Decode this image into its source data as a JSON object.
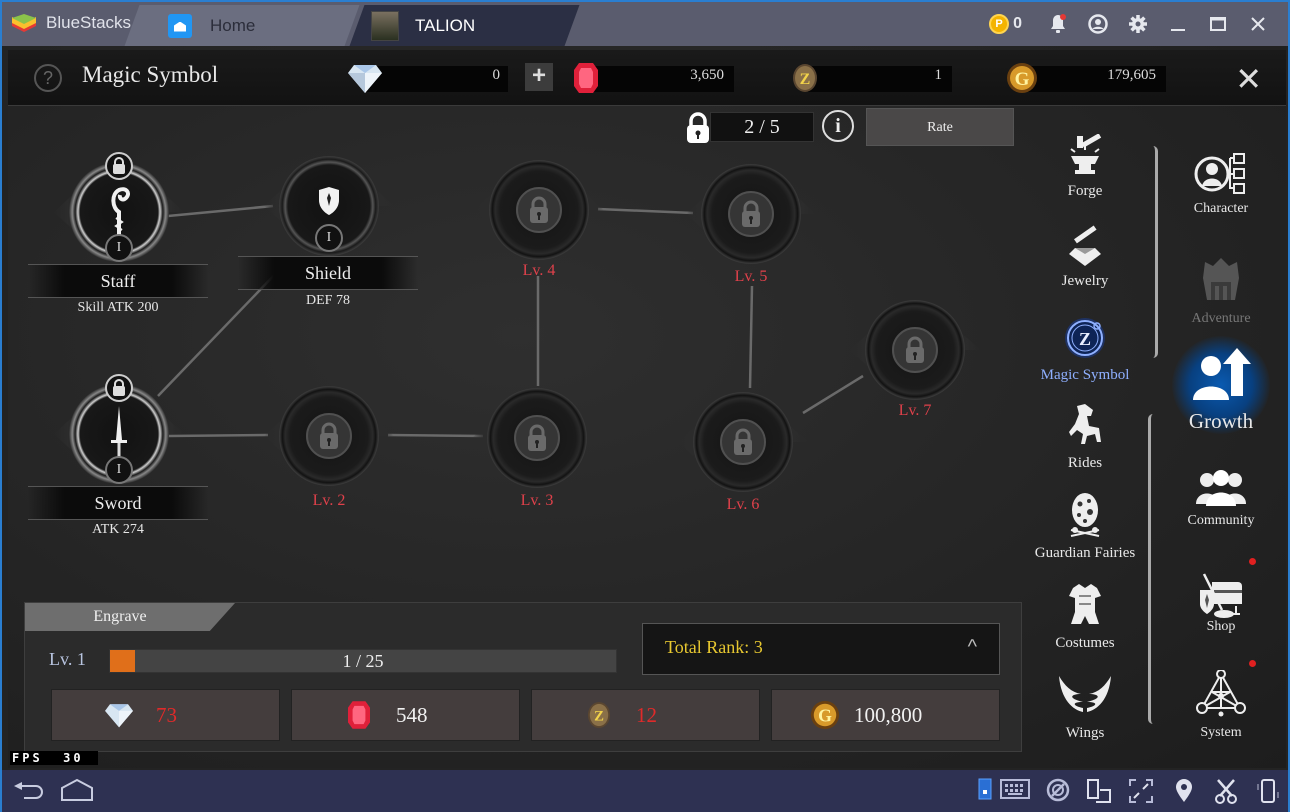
{
  "titlebar": {
    "app_name": "BlueStacks",
    "tabs": [
      {
        "label": "Home",
        "icon": "home-icon"
      },
      {
        "label": "TALION",
        "icon": "game-thumbnail-icon"
      }
    ],
    "coin_count": "0",
    "coin_symbol": "P",
    "window_buttons": [
      "minimize",
      "maximize",
      "close"
    ]
  },
  "header": {
    "help_symbol": "?",
    "title": "Magic Symbol",
    "resources": [
      {
        "name": "diamond",
        "value": "0"
      },
      {
        "name": "ruby",
        "value": "3,650"
      },
      {
        "name": "rune-stone",
        "value": "1"
      },
      {
        "name": "gold",
        "value": "179,605"
      }
    ],
    "plus_label": "+",
    "close_label": "✕"
  },
  "slots": {
    "count": "2 / 5",
    "info_symbol": "i",
    "rate_label": "Rate"
  },
  "nodes": {
    "staff": {
      "name": "Staff",
      "stat": "Skill ATK 200",
      "tier": "I"
    },
    "shield": {
      "name": "Shield",
      "stat": "DEF 78",
      "tier": "I"
    },
    "sword": {
      "name": "Sword",
      "stat": "ATK 274",
      "tier": "I"
    },
    "locked": [
      {
        "label": "Lv. 2"
      },
      {
        "label": "Lv. 3"
      },
      {
        "label": "Lv. 4"
      },
      {
        "label": "Lv. 5"
      },
      {
        "label": "Lv. 6"
      },
      {
        "label": "Lv. 7"
      }
    ]
  },
  "engrave": {
    "tab_label": "Engrave",
    "level_label": "Lv. 1",
    "progress_text": "1 / 25",
    "progress_current": 1,
    "progress_max": 25,
    "total_rank_label": "Total Rank: 3",
    "caret": "^",
    "costs": [
      {
        "resource": "diamond",
        "value": "73",
        "sufficient": false
      },
      {
        "resource": "ruby",
        "value": "548",
        "sufficient": true
      },
      {
        "resource": "rune-stone",
        "value": "12",
        "sufficient": false
      },
      {
        "resource": "gold",
        "value": "100,800",
        "sufficient": true
      }
    ]
  },
  "submenu": [
    {
      "label": "Forge",
      "icon": "forge-anvil-icon"
    },
    {
      "label": "Jewelry",
      "icon": "jewelry-icon"
    },
    {
      "label": "Magic Symbol",
      "icon": "magic-symbol-icon",
      "active": true
    },
    {
      "label": "Rides",
      "icon": "horse-icon"
    },
    {
      "label": "Guardian Fairies",
      "icon": "fairy-egg-icon"
    },
    {
      "label": "Costumes",
      "icon": "armor-icon"
    },
    {
      "label": "Wings",
      "icon": "wings-icon"
    }
  ],
  "mainmenu": [
    {
      "label": "Character",
      "icon": "character-icon"
    },
    {
      "label": "Adventure",
      "icon": "adventure-icon",
      "disabled": true
    },
    {
      "label": "Growth",
      "icon": "growth-icon",
      "active": true
    },
    {
      "label": "Community",
      "icon": "community-icon"
    },
    {
      "label": "Shop",
      "icon": "shop-icon",
      "notification": true
    },
    {
      "label": "System",
      "icon": "system-icon",
      "notification": true
    }
  ],
  "fps": {
    "label": "FPS",
    "value": "30"
  },
  "colors": {
    "accent_blue": "#1a6fc4",
    "locked_red": "#e0414b",
    "rank_gold": "#e8c830",
    "progress_orange": "#e06f1a",
    "active_menu": "#8fb0ff"
  }
}
